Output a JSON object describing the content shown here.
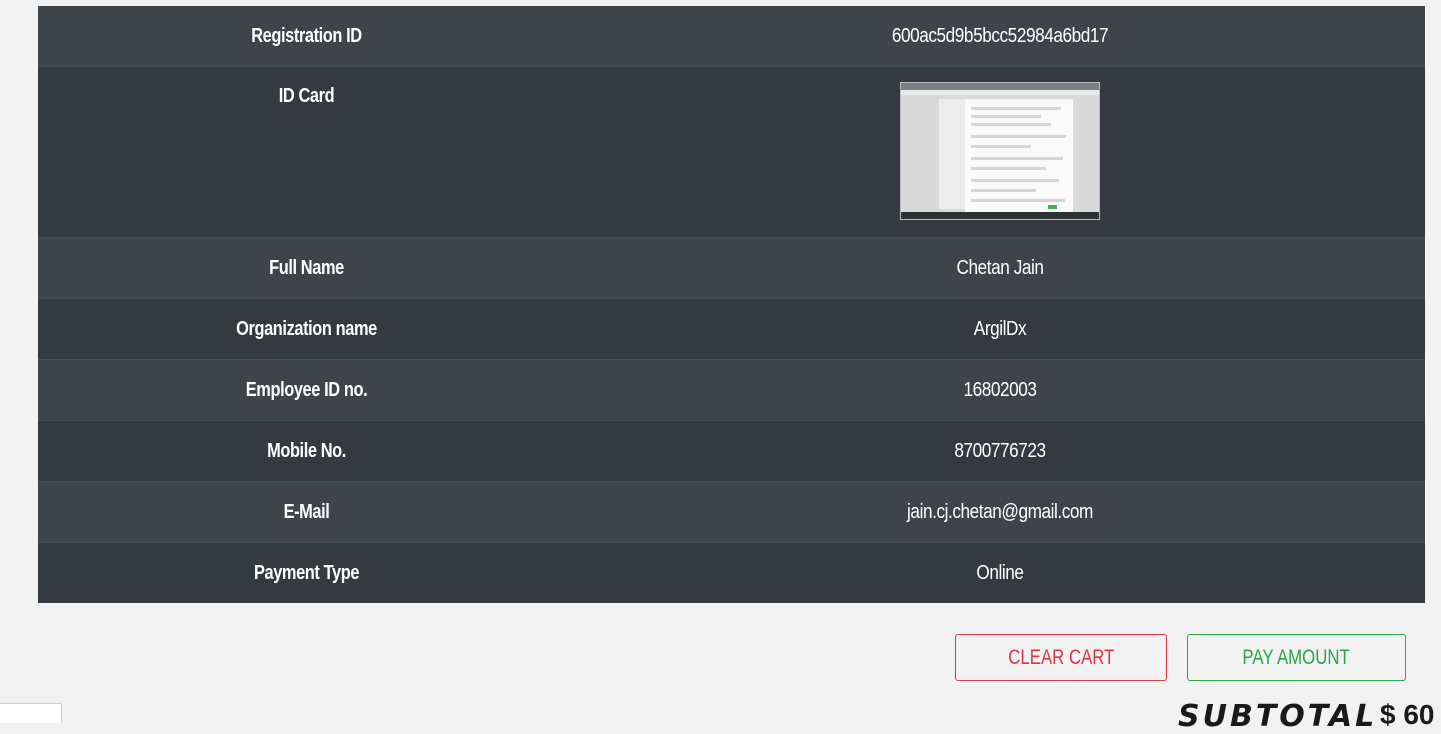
{
  "details": {
    "rows": [
      {
        "label": "Registration ID",
        "value": "600ac5d9b5bcc52984a6bd17"
      },
      {
        "label": "ID Card",
        "value": ""
      },
      {
        "label": "Full Name",
        "value": "Chetan Jain"
      },
      {
        "label": "Organization name",
        "value": "ArgilDx"
      },
      {
        "label": "Employee ID no.",
        "value": "16802003"
      },
      {
        "label": "Mobile No.",
        "value": "8700776723"
      },
      {
        "label": "E-Mail",
        "value": "jain.cj.chetan@gmail.com"
      },
      {
        "label": "Payment Type",
        "value": "Online"
      }
    ]
  },
  "actions": {
    "clear_cart_label": "CLEAR CART",
    "pay_amount_label": "PAY AMOUNT"
  },
  "summary": {
    "subtotal_label": "SUBTOTAL",
    "subtotal_amount": "$ 60"
  },
  "colors": {
    "row_light": "#3f444b",
    "row_dark": "#343a40",
    "danger": "#dc3545",
    "success": "#28a745"
  }
}
